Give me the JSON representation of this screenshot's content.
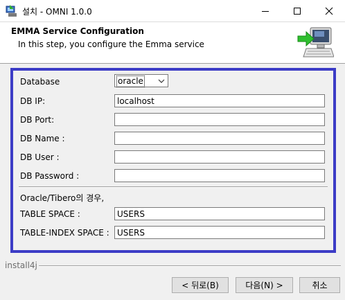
{
  "window": {
    "title": "설치 - OMNI 1.0.0",
    "minimize_icon": "minimize-icon",
    "maximize_icon": "maximize-icon",
    "close_icon": "close-icon"
  },
  "header": {
    "title": "EMMA Service Configuration",
    "subtitle": "In this step, you configure the Emma service",
    "icon": "computer-arrow-icon"
  },
  "form": {
    "database_label": "Database",
    "database_value": "oracle",
    "db_ip_label": "DB IP:",
    "db_ip_value": "localhost",
    "db_port_label": "DB Port:",
    "db_port_value": "",
    "db_name_label": "DB Name :",
    "db_name_value": "",
    "db_user_label": "DB User :",
    "db_user_value": "",
    "db_password_label": "DB Password :",
    "db_password_value": "",
    "oracle_note": "Oracle/Tibero의 경우,",
    "table_space_label": "TABLE SPACE :",
    "table_space_value": "USERS",
    "table_index_space_label": "TABLE-INDEX SPACE :",
    "table_index_space_value": "USERS"
  },
  "footer": {
    "brand": "install4j",
    "back_label": "< 뒤로(B)",
    "next_label": "다음(N) >",
    "cancel_label": "취소"
  },
  "colors": {
    "frame_border": "#3c3cc6",
    "background": "#f0f0f0",
    "arrow_green": "#2fbf2f"
  }
}
